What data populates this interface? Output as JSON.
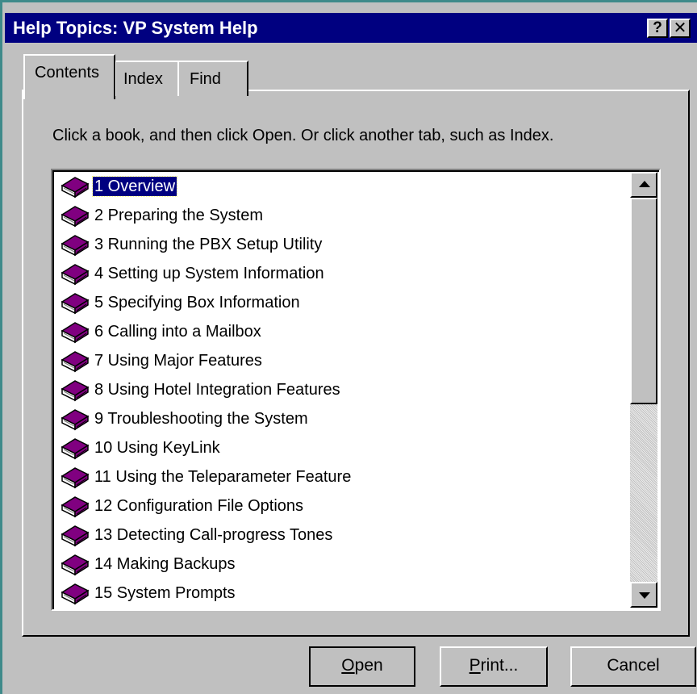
{
  "window": {
    "title": "Help Topics: VP System Help",
    "help_button": "?",
    "close_button": "✕"
  },
  "tabs": [
    {
      "label": "Contents",
      "selected": true
    },
    {
      "label": "Index",
      "selected": false
    },
    {
      "label": "Find",
      "selected": false
    }
  ],
  "instructions": "Click a book, and then click Open. Or click another tab, such as Index.",
  "contents": {
    "items": [
      {
        "label": "1 Overview",
        "icon": "book-icon",
        "selected": true
      },
      {
        "label": "2 Preparing the System",
        "icon": "book-icon"
      },
      {
        "label": "3 Running the PBX Setup Utility",
        "icon": "book-icon"
      },
      {
        "label": "4 Setting up System Information",
        "icon": "book-icon"
      },
      {
        "label": "5 Specifying Box Information",
        "icon": "book-icon"
      },
      {
        "label": "6 Calling into a Mailbox",
        "icon": "book-icon"
      },
      {
        "label": "7 Using Major Features",
        "icon": "book-icon"
      },
      {
        "label": "8 Using Hotel Integration Features",
        "icon": "book-icon"
      },
      {
        "label": "9 Troubleshooting the System",
        "icon": "book-icon"
      },
      {
        "label": "10 Using KeyLink",
        "icon": "book-icon"
      },
      {
        "label": "11 Using the Teleparameter Feature",
        "icon": "book-icon"
      },
      {
        "label": "12 Configuration File Options",
        "icon": "book-icon"
      },
      {
        "label": "13 Detecting Call-progress Tones",
        "icon": "book-icon"
      },
      {
        "label": "14 Making Backups",
        "icon": "book-icon"
      },
      {
        "label": "15 System Prompts",
        "icon": "book-icon"
      }
    ]
  },
  "buttons": {
    "open": {
      "accel": "O",
      "rest": "pen"
    },
    "print": {
      "accel": "P",
      "rest": "rint..."
    },
    "cancel": "Cancel"
  },
  "colors": {
    "titlebar": "#000080",
    "face": "#c0c0c0",
    "selection": "#000080",
    "book": "#800080"
  }
}
